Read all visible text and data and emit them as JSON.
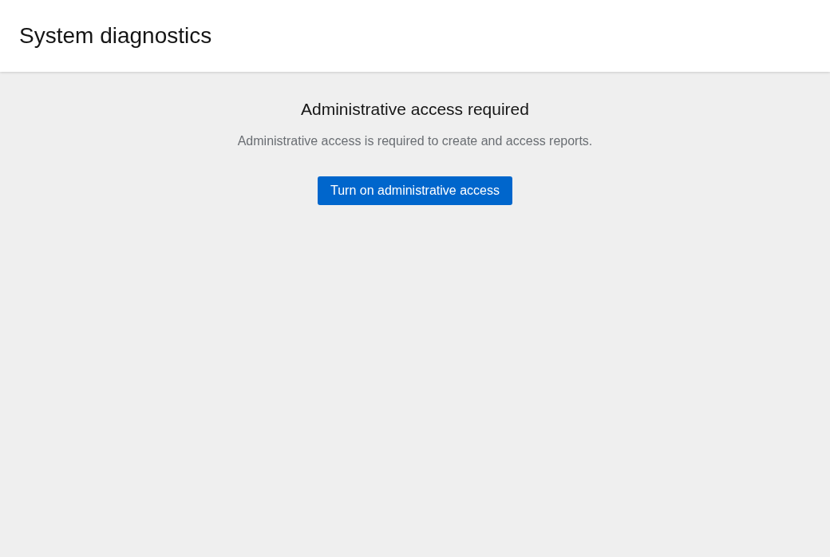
{
  "header": {
    "title": "System diagnostics"
  },
  "empty_state": {
    "title": "Administrative access required",
    "description": "Administrative access is required to create and access reports.",
    "button": "Turn on administrative access"
  }
}
